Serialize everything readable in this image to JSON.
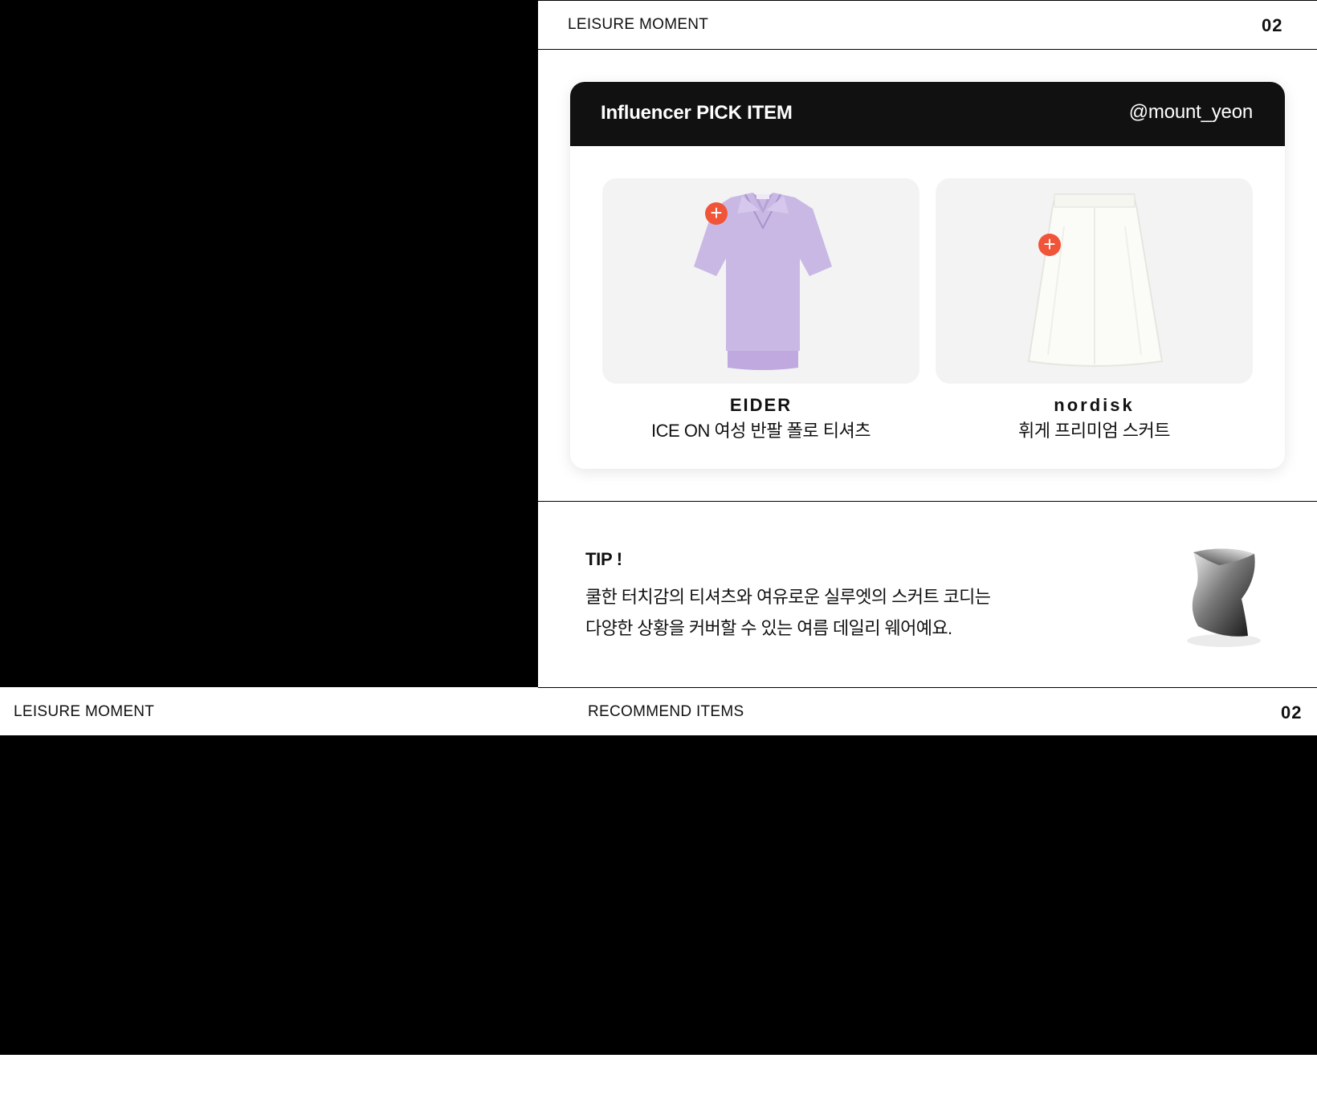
{
  "top_header": {
    "title": "LEISURE MOMENT",
    "number": "02"
  },
  "card": {
    "title": "Influencer PICK ITEM",
    "handle": "@mount_yeon",
    "products": [
      {
        "brand": "EIDER",
        "name": "ICE ON 여성 반팔 폴로 티셔츠",
        "image": "purple-polo-shirt",
        "add_icon": "plus-icon"
      },
      {
        "brand": "nordisk",
        "name": "휘게 프리미엄 스커트",
        "image": "white-skirt",
        "add_icon": "plus-icon"
      }
    ]
  },
  "tip": {
    "label": "TIP !",
    "lines": [
      "쿨한 터치감의 티셔츠와 여유로운 실루엣의 스커트 코디는",
      "다양한 상황을 커버할 수 있는 여름 데일리 웨어예요."
    ]
  },
  "bottom_header": {
    "left": "LEISURE MOMENT",
    "center": "RECOMMEND ITEMS",
    "number": "02"
  },
  "colors": {
    "accent": "#f0553a",
    "dark": "#111111",
    "card_bg": "#f3f3f3"
  }
}
